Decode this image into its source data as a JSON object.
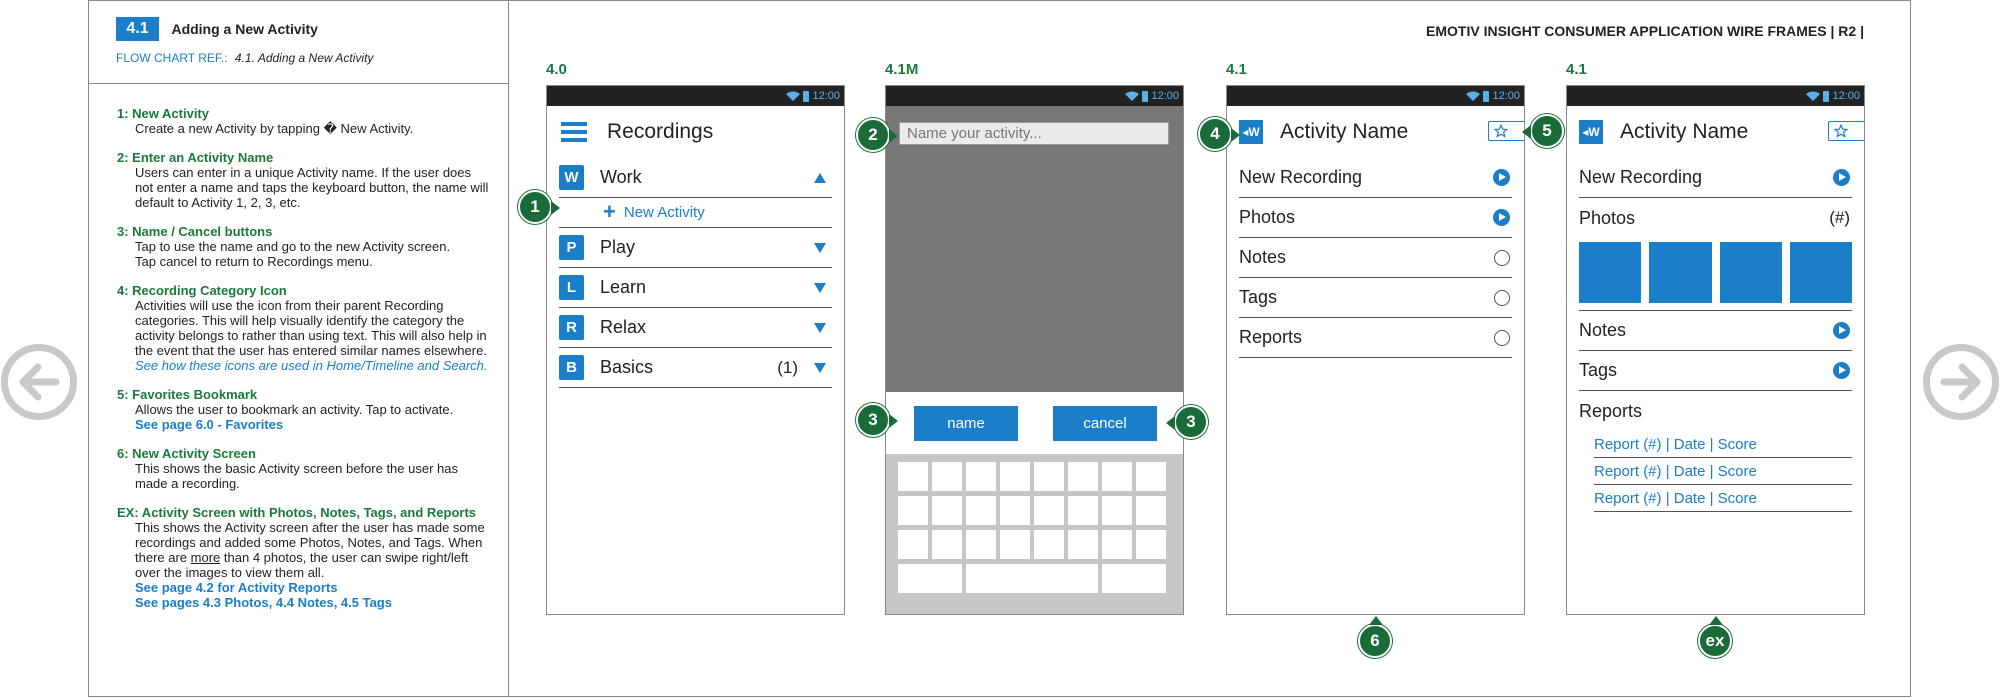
{
  "header": {
    "section_number": "4.1",
    "section_title": "Adding a New Activity",
    "flow_ref_label": "FLOW CHART REF.:",
    "flow_ref_value": "4.1. Adding a New Activity",
    "doc_title": "EMOTIV INSIGHT CONSUMER APPLICATION WIRE FRAMES  | R2 |"
  },
  "notes": [
    {
      "title": "1: New Activity",
      "lines": [
        "Create a new Activity by tapping � New Activity."
      ]
    },
    {
      "title": "2: Enter an Activity Name",
      "lines": [
        "Users can enter in a unique Activity name. If the user does not enter a name and taps the keyboard button, the name will default to Activity 1, 2, 3, etc."
      ]
    },
    {
      "title": "3: Name / Cancel buttons",
      "lines": [
        "Tap to use the name and go to the new Activity screen.",
        "Tap cancel to return to Recordings menu."
      ]
    },
    {
      "title": "4: Recording Category Icon",
      "lines": [
        "Activities will use the icon from their parent Recording categories. This will help visually identify the category the activity belongs to rather than using text. This will also help in the event that the user has entered similar names elsewhere."
      ],
      "link": "See how these icons are used in Home/Timeline and Search."
    },
    {
      "title": "5: Favorites Bookmark",
      "lines": [
        "Allows the user to bookmark an activity. Tap to activate."
      ],
      "link": "See page 6.0 - Favorites"
    },
    {
      "title": "6: New Activity Screen",
      "lines": [
        "This shows the basic Activity screen before the user has made a recording."
      ]
    },
    {
      "title": "EX: Activity Screen with Photos, Notes, Tags, and Reports",
      "lines_a": "This shows the Activity screen after the user has made some recordings and added some Photos, Notes, and Tags. When there are",
      "lines_u": "more",
      "lines_b": "than 4 photos, the user can swipe right/left over the images to view them all.",
      "link1": "See page 4.2 for Activity Reports",
      "link2": "See pages 4.3 Photos, 4.4 Notes, 4.5 Tags"
    }
  ],
  "screens": {
    "s40": {
      "label": "4.0",
      "time": "12:00",
      "title": "Recordings",
      "categories": [
        {
          "icon": "W",
          "label": "Work",
          "count": "",
          "expanded": true
        },
        {
          "icon": "P",
          "label": "Play",
          "count": ""
        },
        {
          "icon": "L",
          "label": "Learn",
          "count": ""
        },
        {
          "icon": "R",
          "label": "Relax",
          "count": ""
        },
        {
          "icon": "B",
          "label": "Basics",
          "count": "(1)"
        }
      ],
      "new_activity": "New Activity"
    },
    "s41m": {
      "label": "4.1M",
      "time": "12:00",
      "placeholder": "Name your activity...",
      "name_btn": "name",
      "cancel_btn": "cancel"
    },
    "s41": {
      "label": "4.1",
      "time": "12:00",
      "icon": "◂W",
      "title": "Activity Name",
      "rows": [
        "New Recording",
        "Photos",
        "Notes",
        "Tags",
        "Reports"
      ]
    },
    "s41ex": {
      "label": "4.1",
      "time": "12:00",
      "icon": "◂W",
      "title": "Activity Name",
      "new_recording": "New Recording",
      "photos": "Photos",
      "photos_count": "(#)",
      "notes": "Notes",
      "tags": "Tags",
      "reports": "Reports",
      "report_links": [
        "Report (#) | Date | Score",
        "Report (#) | Date | Score",
        "Report (#) | Date | Score"
      ]
    }
  },
  "callouts": {
    "c1": "1",
    "c2": "2",
    "c3": "3",
    "c4": "4",
    "c5": "5",
    "c6": "6",
    "cex": "ex"
  },
  "colors": {
    "accent": "#1a7ec8",
    "callout": "#1b6b38",
    "note_heading": "#1b7a3a"
  }
}
